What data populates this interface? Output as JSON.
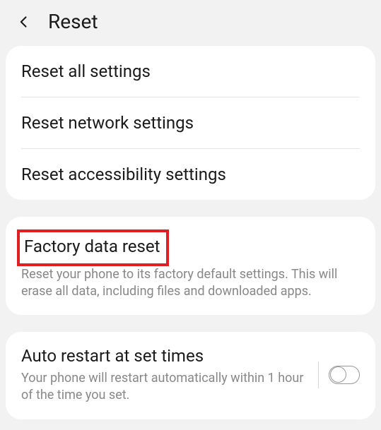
{
  "header": {
    "title": "Reset"
  },
  "group1": {
    "items": [
      {
        "label": "Reset all settings"
      },
      {
        "label": "Reset network settings"
      },
      {
        "label": "Reset accessibility settings"
      }
    ]
  },
  "group2": {
    "title": "Factory data reset",
    "desc": "Reset your phone to its factory default settings. This will erase all data, including files and downloaded apps."
  },
  "group3": {
    "title": "Auto restart at set times",
    "desc": "Your phone will restart automatically within 1 hour of the time you set.",
    "toggle": false
  }
}
